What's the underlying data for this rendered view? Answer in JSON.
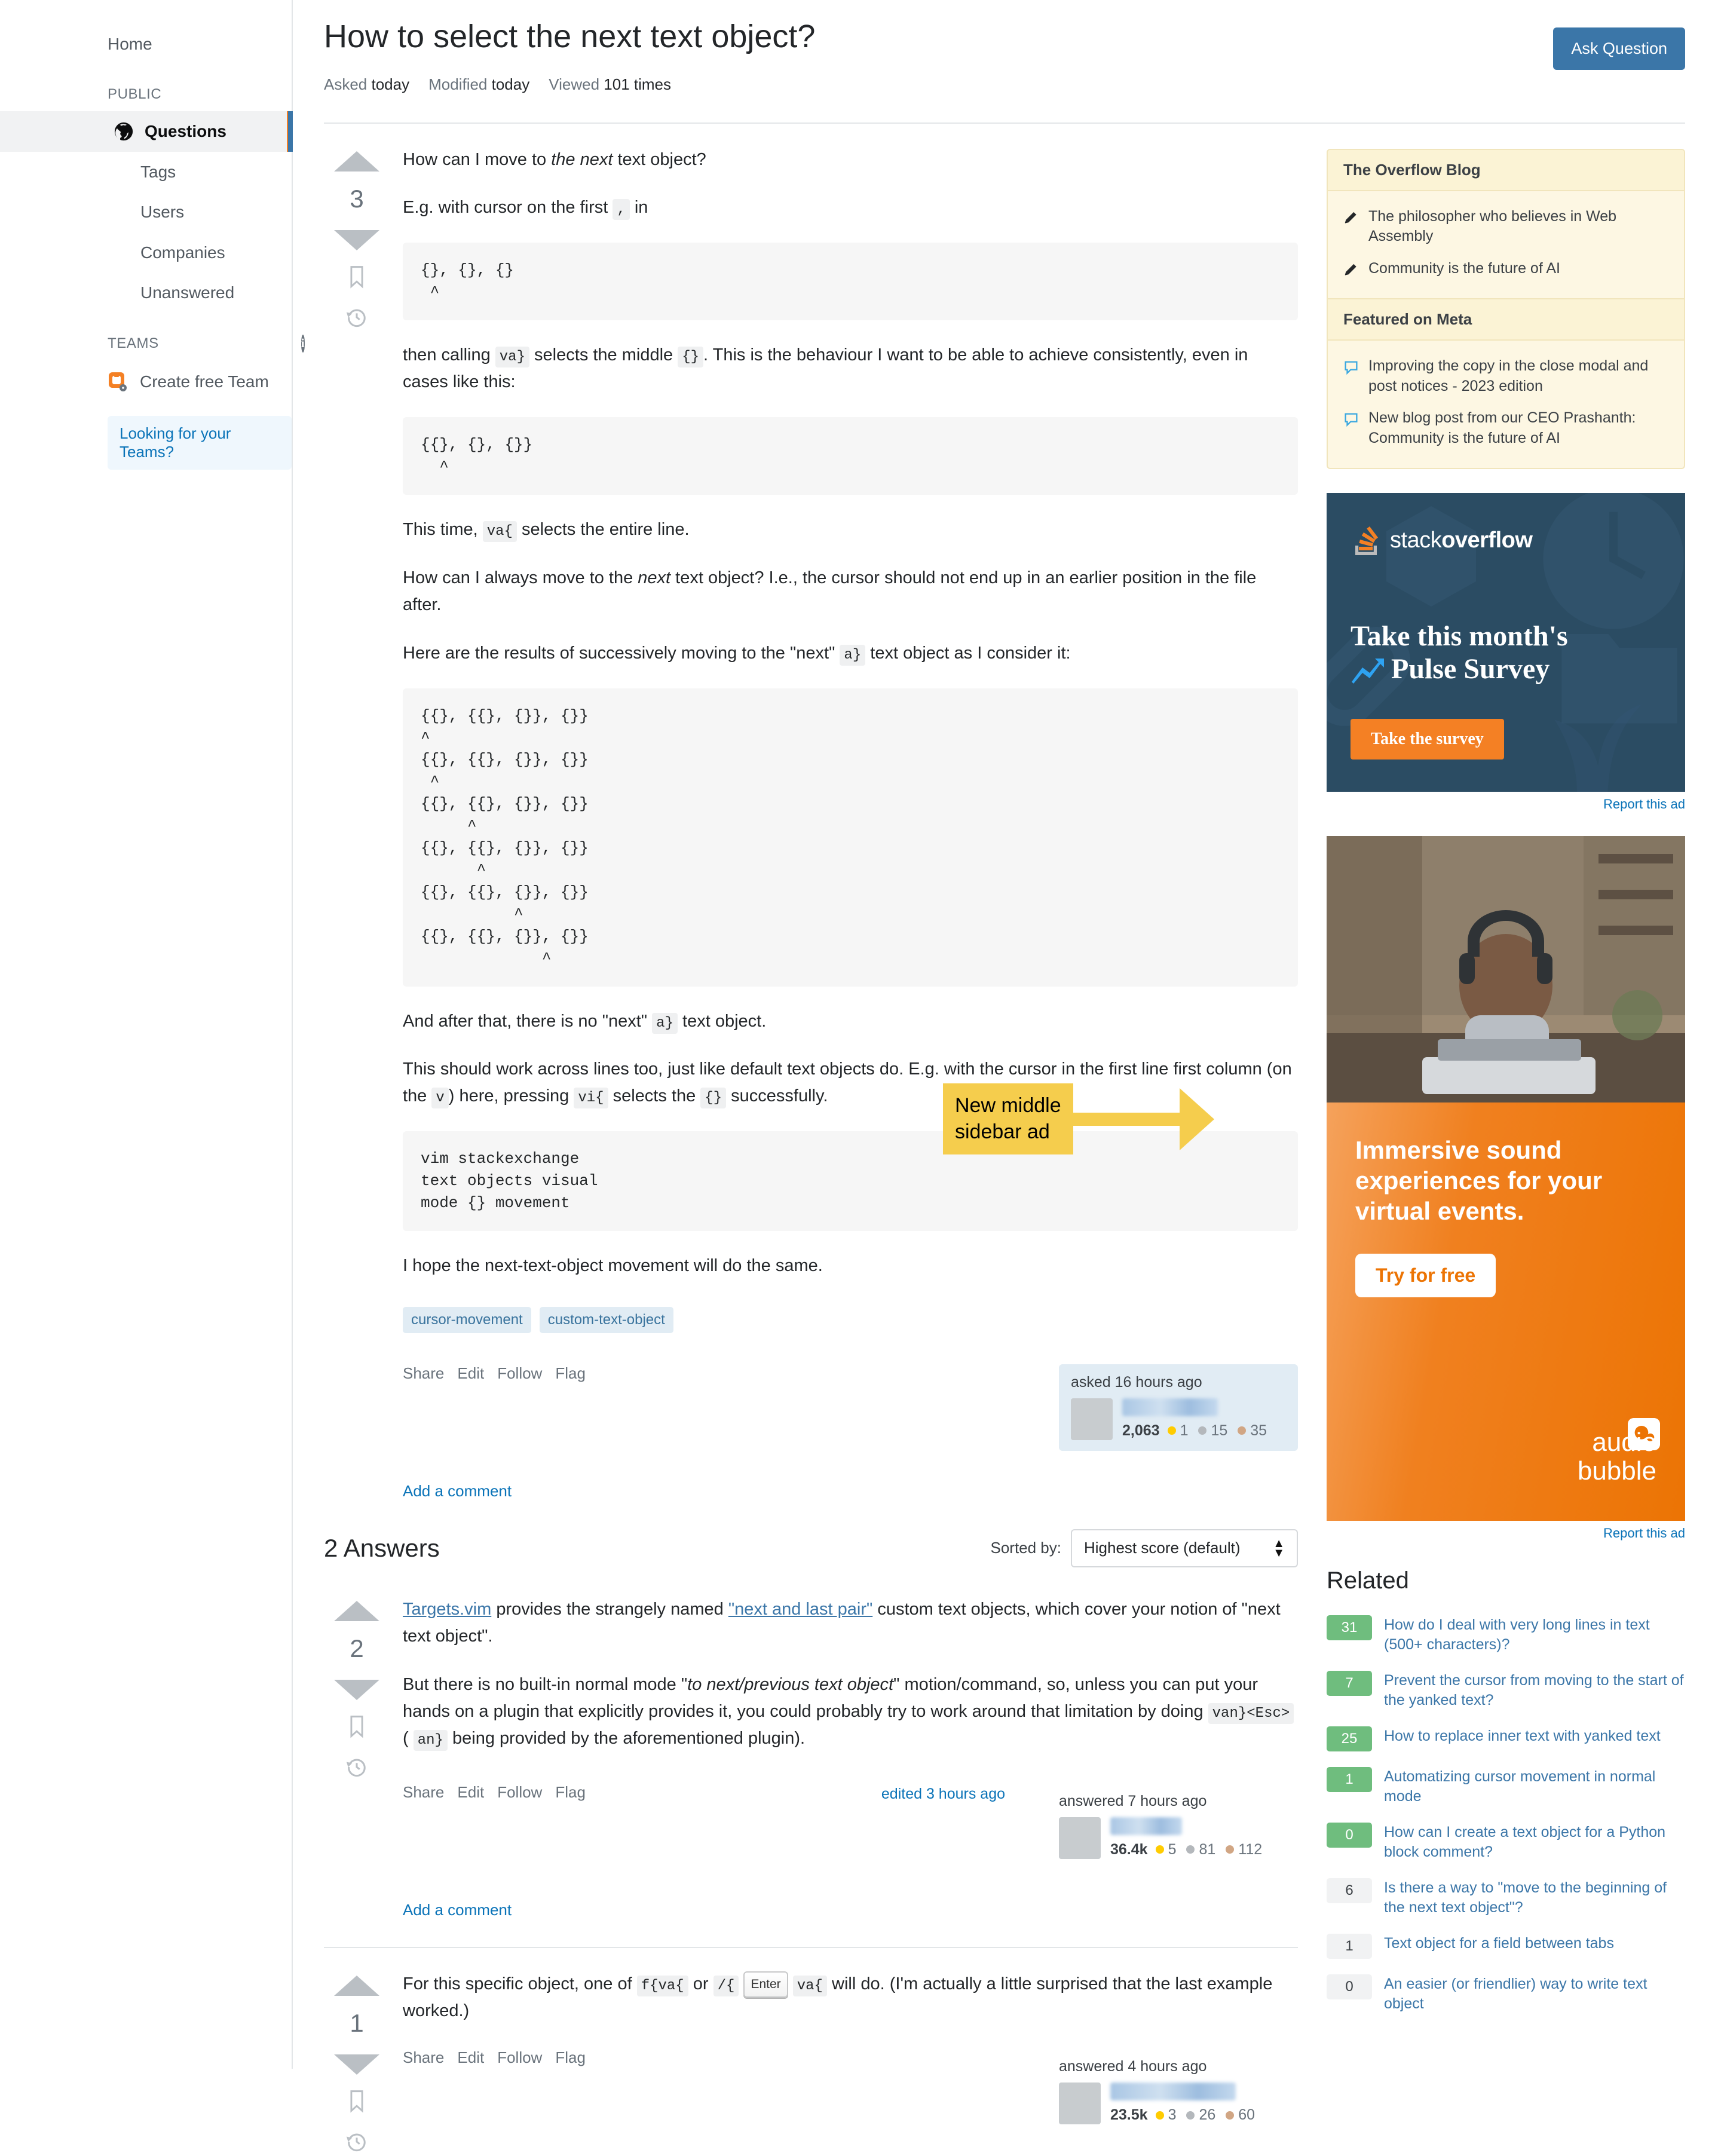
{
  "sidebar": {
    "home": "Home",
    "public_label": "PUBLIC",
    "items": [
      {
        "label": "Questions",
        "icon": "globe-icon",
        "active": true
      },
      {
        "label": "Tags",
        "active": false
      },
      {
        "label": "Users",
        "active": false
      },
      {
        "label": "Companies",
        "active": false
      },
      {
        "label": "Unanswered",
        "active": false
      }
    ],
    "teams_label": "TEAMS",
    "teams_info_icon": "info-icon",
    "create_team": "Create free Team",
    "looking_for_teams": "Looking for your Teams?"
  },
  "header": {
    "title": "How to select the next text object?",
    "ask_button": "Ask Question",
    "meta": {
      "asked_label": "Asked",
      "asked_value": "today",
      "modified_label": "Modified",
      "modified_value": "today",
      "viewed_label": "Viewed",
      "viewed_value": "101 times"
    }
  },
  "question": {
    "votes": "3",
    "para1_a": "How can I move to ",
    "para1_em": "the next",
    "para1_b": " text object?",
    "para2_a": "E.g. with cursor on the first ",
    "para2_code": ",",
    "para2_b": " in",
    "code1": "{}, {}, {}\n ^",
    "para3_a": "then calling ",
    "para3_code1": "va}",
    "para3_b": " selects the middle ",
    "para3_code2": "{}",
    "para3_c": ". This is the behaviour I want to be able to achieve consistently, even in cases like this:",
    "code2": "{{}, {}, {}}\n  ^",
    "para4_a": "This time, ",
    "para4_code": "va{",
    "para4_b": " selects the entire line.",
    "para5_a": "How can I always move to the ",
    "para5_em": "next",
    "para5_b": " text object? I.e., the cursor should not end up in an earlier position in the file after.",
    "para6_a": "Here are the results of successively moving to the \"next\" ",
    "para6_code": "a}",
    "para6_b": " text object as I consider it:",
    "code3": "{{}, {{}, {}}, {}}\n^\n{{}, {{}, {}}, {}}\n ^\n{{}, {{}, {}}, {}}\n     ^\n{{}, {{}, {}}, {}}\n      ^\n{{}, {{}, {}}, {}}\n          ^\n{{}, {{}, {}}, {}}\n             ^",
    "para7_a": "And after that, there is no \"next\" ",
    "para7_code": "a}",
    "para7_b": " text object.",
    "para8_a": "This should work across lines too, just like default text objects do. E.g. with the cursor in the first line first column (on the ",
    "para8_code1": "v",
    "para8_b": ") here, pressing ",
    "para8_code2": "vi{",
    "para8_c": " selects the ",
    "para8_code3": "{}",
    "para8_d": " successfully.",
    "code4": "vim stackexchange\ntext objects visual\nmode {} movement",
    "para9": "I hope the next-text-object movement will do the same.",
    "tags": [
      "cursor-movement",
      "custom-text-object"
    ],
    "actions": [
      "Share",
      "Edit",
      "Follow",
      "Flag"
    ],
    "owner": {
      "time": "asked 16 hours ago",
      "rep": "2,063",
      "gold": "1",
      "silver": "15",
      "bronze": "35"
    },
    "add_comment": "Add a comment"
  },
  "answers_section": {
    "heading": "2 Answers",
    "sorted_by_label": "Sorted by:",
    "sort_value": "Highest score (default)"
  },
  "answers": [
    {
      "votes": "2",
      "p1_link1": "Targets.vim",
      "p1_a": " provides the strangely named ",
      "p1_link2": "\"next and last pair\"",
      "p1_b": " custom text objects, which cover your notion of \"next text object\".",
      "p2_a": "But there is no built-in normal mode \"",
      "p2_em": "to next/previous text object",
      "p2_b": "\" motion/command, so, unless you can put your hands on a plugin that explicitly provides it, you could probably try to work around that limitation by doing ",
      "p2_code1": "van}<Esc>",
      "p2_c": " ( ",
      "p2_code2": "an}",
      "p2_d": " being provided by the aforementioned plugin).",
      "actions": [
        "Share",
        "Edit",
        "Follow",
        "Flag"
      ],
      "edited": "edited 3 hours ago",
      "owner": {
        "time": "answered 7 hours ago",
        "rep": "36.4k",
        "gold": "5",
        "silver": "81",
        "bronze": "112"
      },
      "add_comment": "Add a comment"
    },
    {
      "votes": "1",
      "p1_a": "For this specific object, one of ",
      "p1_code1": "f{va{",
      "p1_b": " or ",
      "p1_code2": "/{",
      "p1_kbd": "Enter",
      "p1_code3": "va{",
      "p1_c": " will do. (I'm actually a little surprised that the last example worked.)",
      "actions": [
        "Share",
        "Edit",
        "Follow",
        "Flag"
      ],
      "owner": {
        "time": "answered 4 hours ago",
        "rep": "23.5k",
        "gold": "3",
        "silver": "26",
        "bronze": "60"
      }
    }
  ],
  "blog": {
    "overflow_title": "The Overflow Blog",
    "overflow_items": [
      "The philosopher who believes in Web Assembly",
      "Community is the future of AI"
    ],
    "meta_title": "Featured on Meta",
    "meta_items": [
      "Improving the copy in the close modal and post notices - 2023 edition",
      "New blog post from our CEO Prashanth: Community is the future of AI"
    ]
  },
  "ads": [
    {
      "brand_text_a": "stack",
      "brand_text_b": "overflow",
      "headline_line1": "Take this month's",
      "headline_line2": "Pulse Survey",
      "cta": "Take the survey",
      "report": "Report this ad"
    },
    {
      "headline": "Immersive sound experiences for your virtual events.",
      "cta": "Try for free",
      "brand_line1": "audio",
      "brand_line2": "bubble",
      "report": "Report this ad"
    }
  ],
  "annotation": {
    "text": "New middle\nsidebar ad",
    "color": "#f5cd4d"
  },
  "related": {
    "title": "Related",
    "items": [
      {
        "score": "31",
        "highlight": true,
        "title": "How do I deal with very long lines in text (500+ characters)?"
      },
      {
        "score": "7",
        "highlight": true,
        "title": "Prevent the cursor from moving to the start of the yanked text?"
      },
      {
        "score": "25",
        "highlight": true,
        "title": "How to replace inner text with yanked text"
      },
      {
        "score": "1",
        "highlight": true,
        "title": "Automatizing cursor movement in normal mode"
      },
      {
        "score": "0",
        "highlight": true,
        "title": "How can I create a text object for a Python block comment?"
      },
      {
        "score": "6",
        "highlight": false,
        "title": "Is there a way to \"move to the beginning of the next text object\"?"
      },
      {
        "score": "1",
        "highlight": false,
        "title": "Text object for a field between tabs"
      },
      {
        "score": "0",
        "highlight": false,
        "title": "An easier (or friendlier) way to write text object"
      }
    ]
  },
  "colors": {
    "accent_orange": "#f48024",
    "link_blue": "#0a73b8",
    "tag_blue": "#39739d",
    "annotation_yellow": "#f5cd4d",
    "button_blue": "#3b76a8"
  }
}
